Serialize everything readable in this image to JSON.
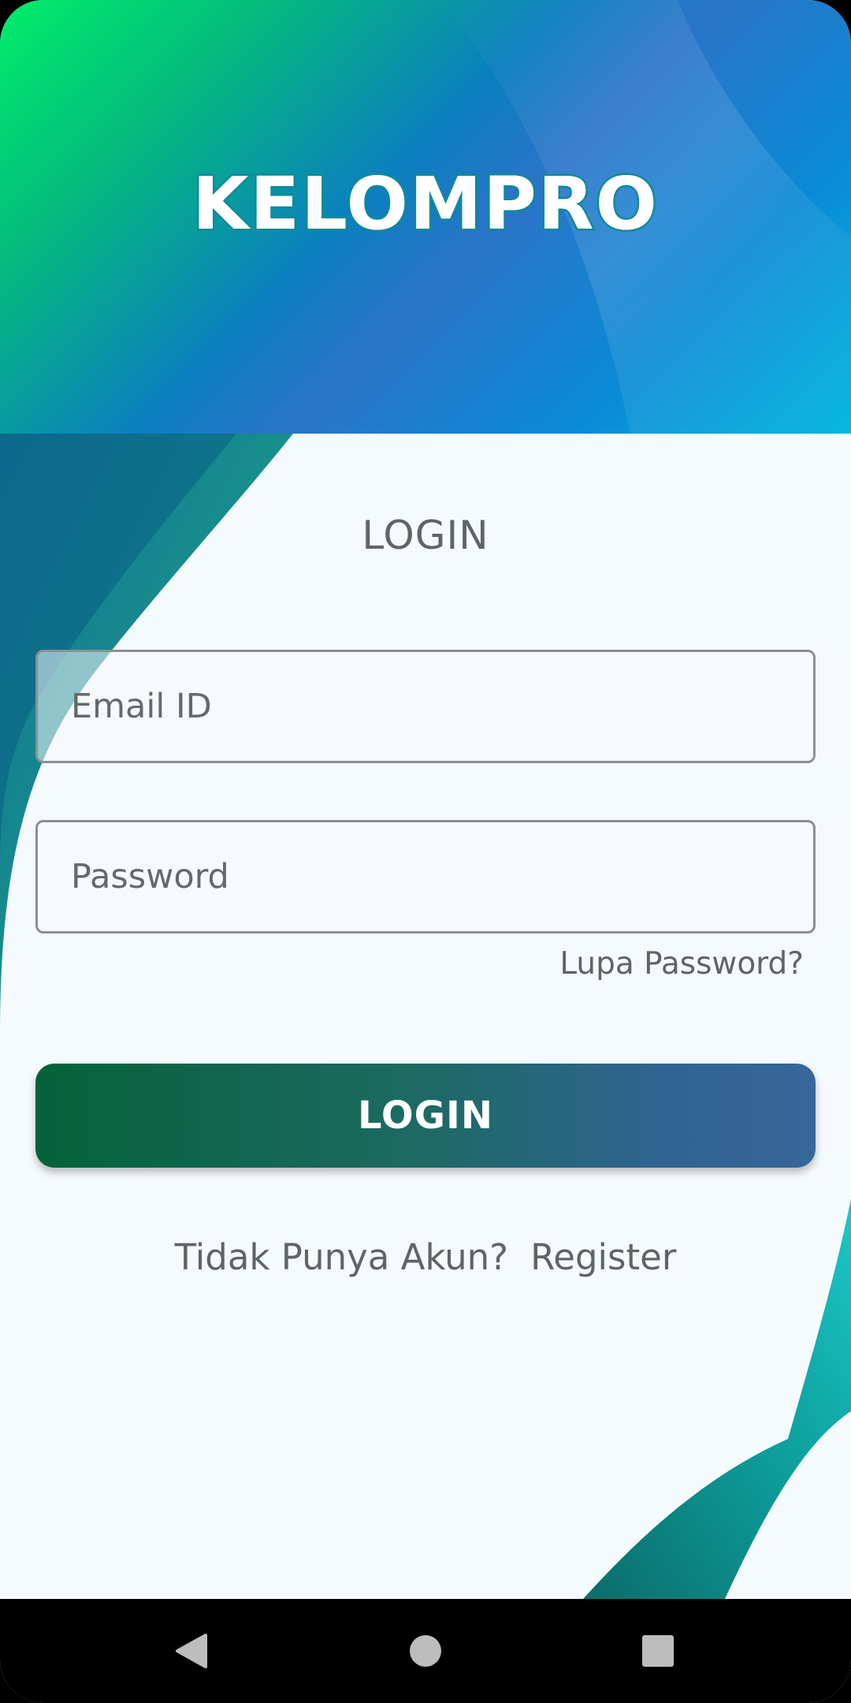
{
  "app": {
    "logo_text": "KELOMPRO"
  },
  "login": {
    "title": "LOGIN",
    "email_placeholder": "Email ID",
    "password_placeholder": "Password",
    "forgot_label": "Lupa Password?",
    "submit_label": "LOGIN",
    "no_account_label": "Tidak Punya Akun?",
    "register_label": "Register"
  },
  "navbar": {
    "back_icon": "back-triangle-icon",
    "home_icon": "home-circle-icon",
    "recent_icon": "recent-square-icon"
  },
  "colors": {
    "gradient_start": "#00ee6a",
    "gradient_mid": "#2a74c8",
    "gradient_end": "#06b9de",
    "button_start": "#03623a",
    "button_end": "#376799",
    "text_gray": "#5f6466",
    "background": "#f5fafd"
  }
}
